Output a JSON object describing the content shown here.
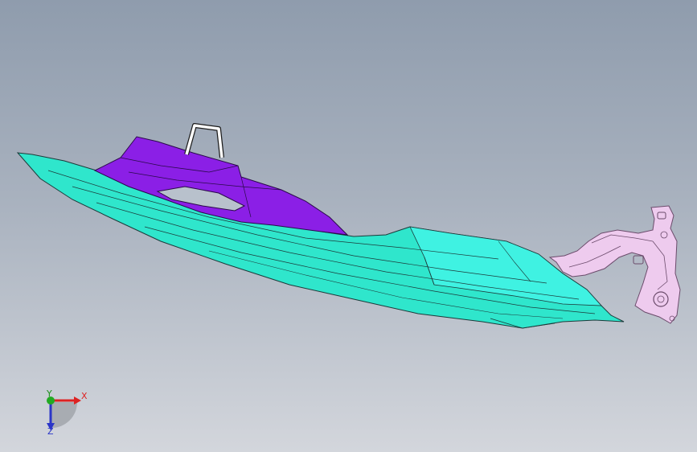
{
  "viewport": {
    "background_top": "#8f9cad",
    "background_bottom": "#d3d6dc"
  },
  "model": {
    "hull_color": "#2fe6cc",
    "upper_color": "#8b1fe6",
    "bracket_color": "#eecbee",
    "handle_color": "#ffffff",
    "edge_color": "#1c3a3a"
  },
  "triad": {
    "x_label": "X",
    "y_label": "Y",
    "z_label": "Z",
    "x_color": "#dd2222",
    "y_color": "#22aa22",
    "z_color": "#2a35c8"
  }
}
